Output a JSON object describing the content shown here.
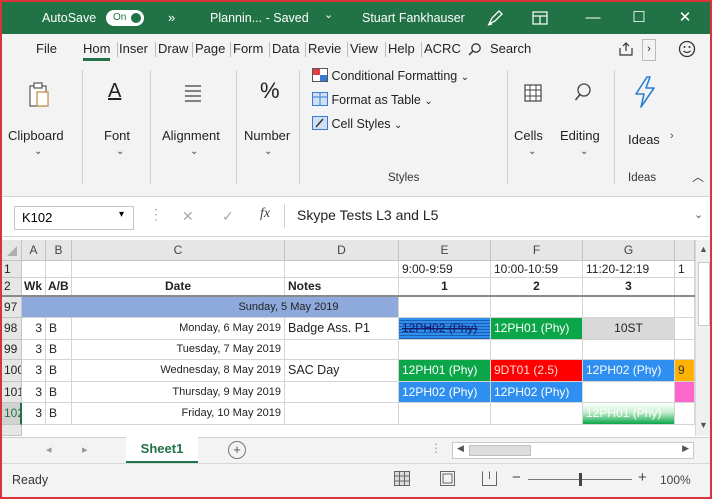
{
  "titlebar": {
    "autosave_label": "AutoSave",
    "autosave_state": "On",
    "more_glyph": "»",
    "filename": "Plannin... - Saved",
    "dropdown_glyph": "⌄",
    "user": "Stuart Fankhauser",
    "minimize": "—",
    "maximize": "☐",
    "close": "✕",
    "bar_color": "#217346"
  },
  "tabs": [
    "File",
    "Hom",
    "Inser",
    "Draw",
    "Page",
    "Form",
    "Data",
    "Revie",
    "View",
    "Help",
    "ACRC"
  ],
  "search_label": "Search",
  "ribbon": {
    "clipboard": "Clipboard",
    "font": "Font",
    "alignment": "Alignment",
    "number": "Number",
    "conditional_formatting": "Conditional Formatting",
    "format_as_table": "Format as Table",
    "cell_styles": "Cell Styles",
    "styles_group": "Styles",
    "cells": "Cells",
    "editing": "Editing",
    "ideas": "Ideas",
    "ideas_group": "Ideas",
    "number_symbol": "%",
    "font_symbol": "A"
  },
  "formula_bar": {
    "name_box": "K102",
    "fx": "fx",
    "cancel": "✕",
    "enter": "✓",
    "content": "Skype Tests L3 and L5"
  },
  "grid": {
    "columns": [
      "A",
      "B",
      "C",
      "D",
      "E",
      "F",
      "G"
    ],
    "rows": [
      {
        "num": "1",
        "a": "",
        "b": "",
        "c": "",
        "d": "",
        "e": "9:00-9:59",
        "f": "10:00-10:59",
        "g": "11:20-12:19"
      },
      {
        "num": "2",
        "a": "Wk",
        "b": "A/B",
        "c": "Date",
        "d": "Notes",
        "e": "1",
        "f": "2",
        "g": "3"
      },
      {
        "num": "97",
        "a": "",
        "b": "",
        "c": "Sunday, 5 May 2019",
        "d": "",
        "e": "",
        "f": "",
        "g": ""
      },
      {
        "num": "98",
        "a": "3",
        "b": "B",
        "c": "Monday, 6 May 2019",
        "d": "Badge Ass. P1",
        "e": "12PH02 (Phy)",
        "f": "12PH01 (Phy)",
        "g": "10ST"
      },
      {
        "num": "99",
        "a": "3",
        "b": "B",
        "c": "Tuesday, 7 May 2019",
        "d": "",
        "e": "",
        "f": "",
        "g": ""
      },
      {
        "num": "100",
        "a": "3",
        "b": "B",
        "c": "Wednesday, 8 May 2019",
        "d": "SAC Day",
        "e": "12PH01 (Phy)",
        "f": "9DT01 (2.5)",
        "g": "12PH02 (Phy)"
      },
      {
        "num": "101",
        "a": "3",
        "b": "B",
        "c": "Thursday, 9 May 2019",
        "d": "",
        "e": "12PH02 (Phy)",
        "f": "12PH02 (Phy)",
        "g": ""
      },
      {
        "num": "102",
        "a": "3",
        "b": "B",
        "c": "Friday, 10 May 2019",
        "d": "",
        "e": "",
        "f": "",
        "g": "12PH01 (Phy)"
      }
    ],
    "colors": {
      "blue": "#2e8ff0",
      "green": "#0aa648",
      "red": "#ff0000",
      "gray": "#d9d9d9",
      "sunday": "#8ea9db",
      "orange": "#ffb300",
      "pink": "#ff66cc"
    }
  },
  "sheet": {
    "name": "Sheet1",
    "add": "+"
  },
  "status": {
    "ready": "Ready",
    "zoom": "100%",
    "minus": "−",
    "plus": "+"
  }
}
